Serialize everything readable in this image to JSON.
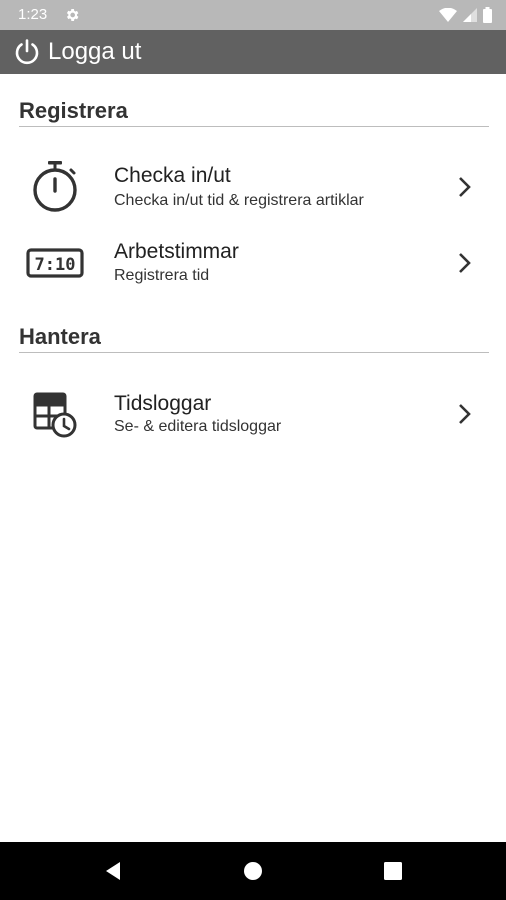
{
  "status_bar": {
    "time": "1:23",
    "icons": [
      "settings-icon",
      "wifi-icon",
      "signal-icon",
      "battery-icon"
    ]
  },
  "app_bar": {
    "logout_label": "Logga ut",
    "logout_icon": "power-icon",
    "background": "#616161"
  },
  "sections": [
    {
      "header": "Registrera",
      "items": [
        {
          "title": "Checka in/ut",
          "subtitle": "Checka in/ut tid & registrera artiklar",
          "icon": "stopwatch-icon"
        },
        {
          "title": "Arbetstimmar",
          "subtitle": "Registrera tid",
          "icon": "digital-clock-icon",
          "icon_text": "7:10"
        }
      ]
    },
    {
      "header": "Hantera",
      "items": [
        {
          "title": "Tidsloggar",
          "subtitle": "Se- & editera tidsloggar",
          "icon": "timesheet-icon"
        }
      ]
    }
  ],
  "nav_bar": {
    "buttons": [
      "back-icon",
      "home-icon",
      "recents-icon"
    ]
  }
}
